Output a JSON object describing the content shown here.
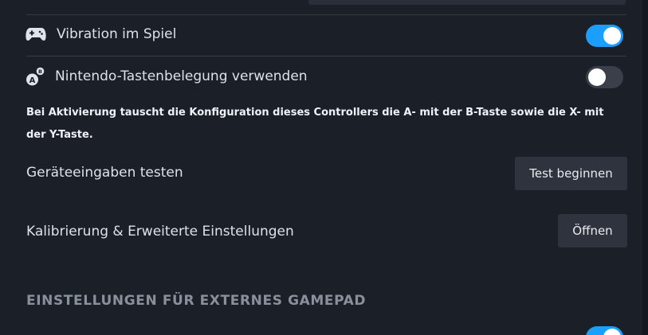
{
  "settings": {
    "vibration": {
      "label": "Vibration im Spiel",
      "icon": "gamepad-icon",
      "enabled": true
    },
    "nintendo_layout": {
      "label": "Nintendo-Tastenbelegung verwenden",
      "icon": "button-swap-icon",
      "icon_letters": [
        "A",
        "B"
      ],
      "enabled": false,
      "description": "Bei Aktivierung tauscht die Konfiguration dieses Controllers die A- mit der B-Taste sowie die X- mit der Y-Taste."
    },
    "test_inputs": {
      "label": "Geräteeingaben testen",
      "button_label": "Test beginnen"
    },
    "calibration": {
      "label": "Kalibrierung & Erweiterte Einstellungen",
      "button_label": "Öffnen"
    }
  },
  "external_gamepad": {
    "section_title": "EINSTELLUNGEN FÜR EXTERNES GAMEPAD",
    "partial_toggle_enabled": true
  },
  "colors": {
    "background": "#1b1f28",
    "toggle_on": "#1a9fff",
    "toggle_off": "#3a3f4a",
    "button_bg": "#2e333d",
    "section_header": "#8a909b"
  }
}
